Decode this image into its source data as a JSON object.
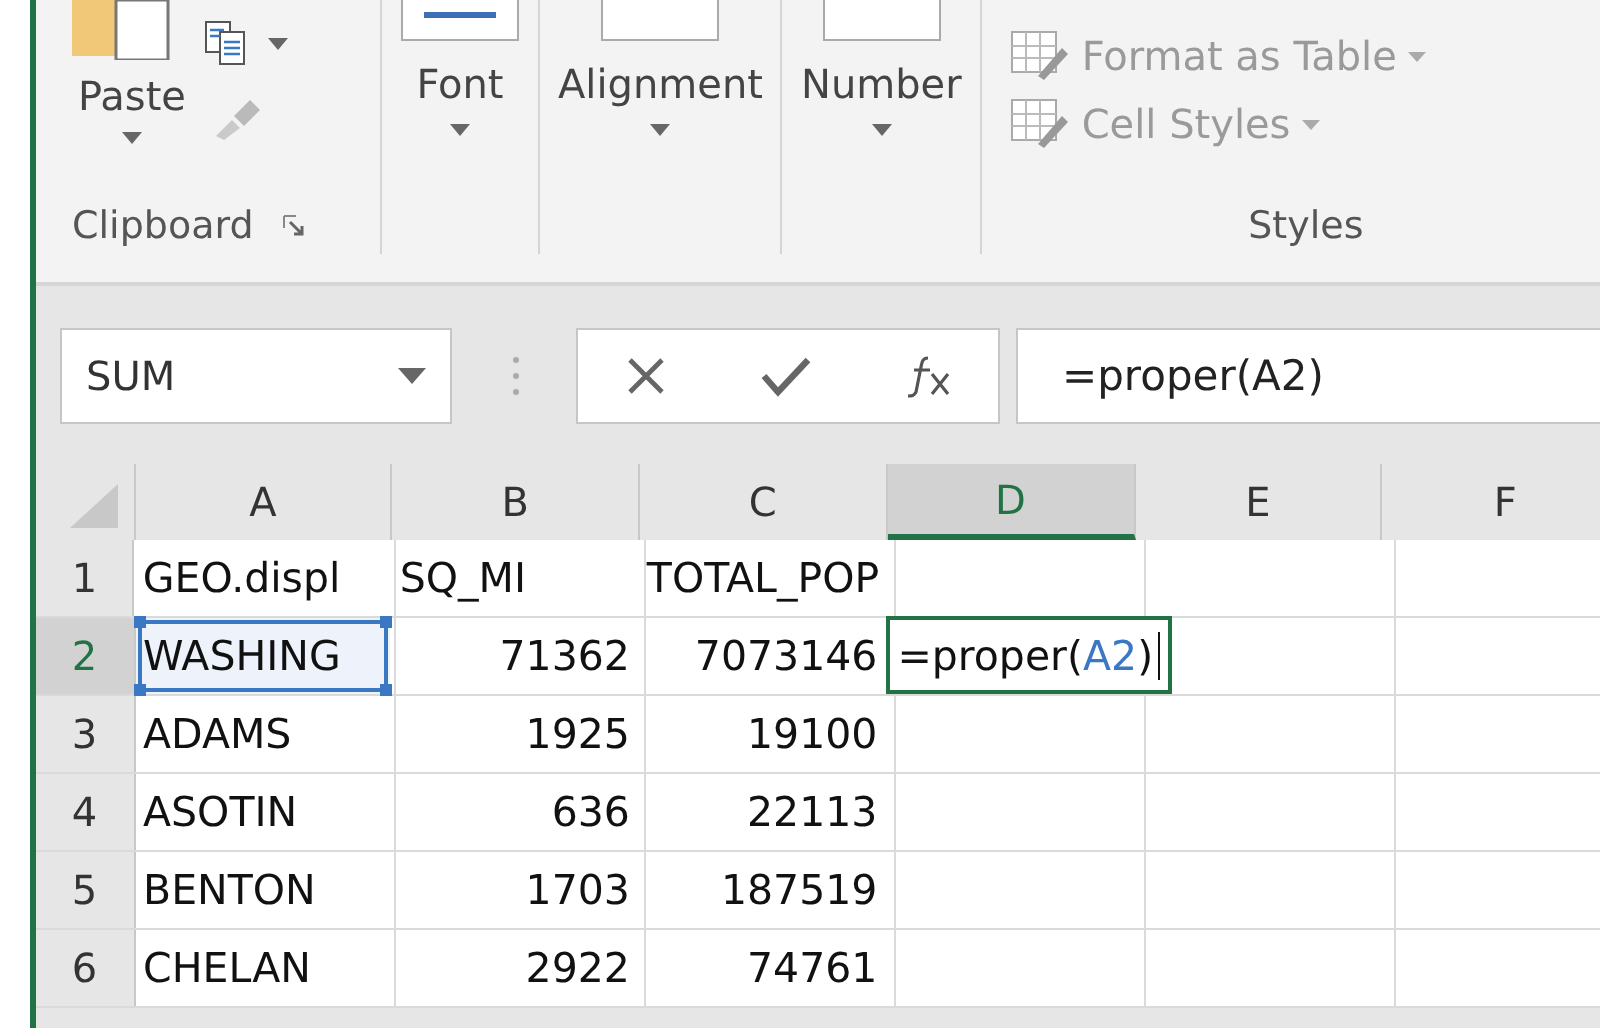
{
  "ribbon": {
    "groups": [
      {
        "kind": "clipboard",
        "label": "Clipboard",
        "paste": "Paste",
        "format_painter_disabled": true
      },
      {
        "kind": "collapsed",
        "button": "Font"
      },
      {
        "kind": "collapsed",
        "button": "Alignment"
      },
      {
        "kind": "collapsed",
        "button": "Number"
      },
      {
        "kind": "styles",
        "label": "Styles",
        "items": [
          {
            "label": "Format as Table",
            "disabled": true
          },
          {
            "label": "Cell Styles",
            "disabled": true
          }
        ]
      }
    ]
  },
  "formula_bar": {
    "name_box": "SUM",
    "formula": "=proper(A2)"
  },
  "sheet": {
    "columns": [
      {
        "label": "A",
        "selected": false
      },
      {
        "label": "B",
        "selected": false
      },
      {
        "label": "C",
        "selected": false
      },
      {
        "label": "D",
        "selected": true
      },
      {
        "label": "E",
        "selected": false
      },
      {
        "label": "F",
        "selected": false
      }
    ],
    "rows": [
      {
        "label": "1",
        "selected": false,
        "cells": [
          {
            "text": "GEO.displ",
            "kind": "text"
          },
          {
            "text": "SQ_MI",
            "kind": "text"
          },
          {
            "text": "TOTAL_POP",
            "kind": "text"
          }
        ]
      },
      {
        "label": "2",
        "selected": true,
        "cells": [
          {
            "text": "WASHING",
            "kind": "text",
            "referenced": true
          },
          {
            "text": "71362",
            "kind": "number"
          },
          {
            "text": "7073146",
            "kind": "number"
          },
          {
            "kind": "editing",
            "parts": [
              {
                "text": "=proper(",
                "kind": "plain"
              },
              {
                "text": "A2",
                "kind": "ref"
              },
              {
                "text": ")",
                "kind": "plain"
              }
            ]
          }
        ]
      },
      {
        "label": "3",
        "selected": false,
        "cells": [
          {
            "text": "ADAMS",
            "kind": "text"
          },
          {
            "text": "1925",
            "kind": "number"
          },
          {
            "text": "19100",
            "kind": "number"
          }
        ]
      },
      {
        "label": "4",
        "selected": false,
        "cells": [
          {
            "text": "ASOTIN",
            "kind": "text"
          },
          {
            "text": "636",
            "kind": "number"
          },
          {
            "text": "22113",
            "kind": "number"
          }
        ]
      },
      {
        "label": "5",
        "selected": false,
        "cells": [
          {
            "text": "BENTON",
            "kind": "text"
          },
          {
            "text": "1703",
            "kind": "number"
          },
          {
            "text": "187519",
            "kind": "number"
          }
        ]
      },
      {
        "label": "6",
        "selected": false,
        "cells": [
          {
            "text": "CHELAN",
            "kind": "text"
          },
          {
            "text": "2922",
            "kind": "number"
          },
          {
            "text": "74761",
            "kind": "number"
          }
        ]
      }
    ]
  }
}
